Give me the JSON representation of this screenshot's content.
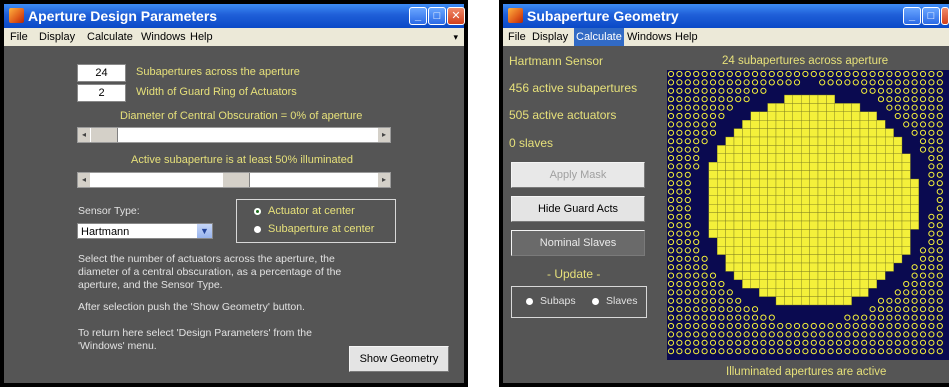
{
  "aperture_window": {
    "title": "Aperture Design Parameters",
    "menu": [
      "File",
      "Display",
      "Calculate",
      "Windows",
      "Help"
    ],
    "subapertures_value": "24",
    "subapertures_label": "Subapertures across the aperture",
    "guard_ring_value": "2",
    "guard_ring_label": "Width of Guard Ring of Actuators",
    "obscuration_label": "Diameter of Central Obscuration = 0% of aperture",
    "obscuration_slider_level": 0,
    "illumination_label": "Active subaperture is at least 50% illuminated",
    "illumination_slider_level": 0.5,
    "sensor_type_label": "Sensor Type:",
    "sensor_type_value": "Hartmann",
    "radio_options": [
      "Actuator at center",
      "Subaperture at center"
    ],
    "radio_selected": 0,
    "help_text_1": "Select the number of actuators across the aperture, the diameter of a central obscuration, as a percentage of the aperture, and the Sensor Type.",
    "help_text_2": "After selection push the 'Show Geometry' button.",
    "help_text_3": "To return here select 'Design Parameters' from the 'Windows' menu.",
    "show_geometry_button": "Show Geometry"
  },
  "geometry_window": {
    "title": "Subaperture Geometry",
    "menu": [
      "File",
      "Display",
      "Calculate",
      "Windows",
      "Help"
    ],
    "active_menu": "Calculate",
    "sensor_name": "Hartmann Sensor",
    "active_subapertures": "456 active subapertures",
    "active_actuators": "505 active actuators",
    "slaves": "0 slaves",
    "apply_mask_button": "Apply Mask",
    "hide_guard_button": "Hide Guard Acts",
    "nominal_slaves_button": "Nominal Slaves",
    "update_label": "- Update -",
    "update_options": [
      "Subaps",
      "Slaves"
    ],
    "plot_title": "24 subapertures across aperture",
    "plot_caption": "Illuminated apertures are active",
    "colors": {
      "illuminated": "#f4f03a",
      "actuator": "#f4f03a",
      "background": "#0a0a50"
    }
  }
}
